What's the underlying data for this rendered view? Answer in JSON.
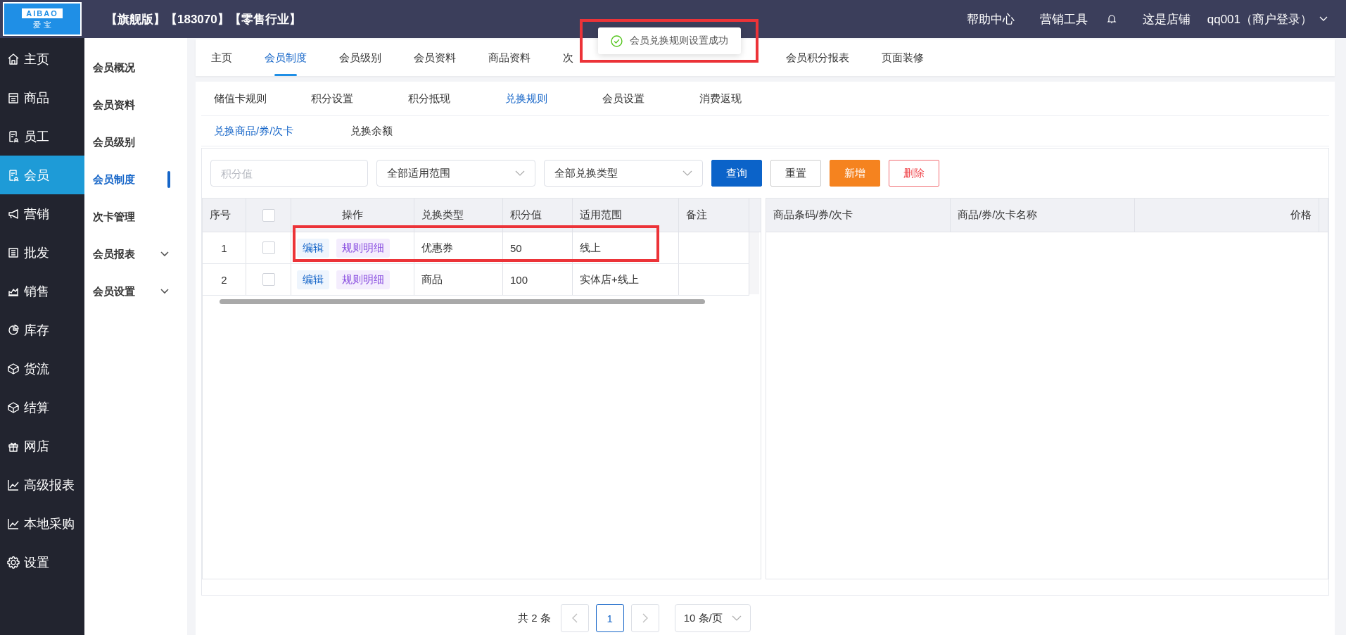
{
  "header": {
    "logo_top": "AIBAO",
    "logo_bottom": "爱 宝",
    "title": "【旗舰版】【183070】【零售行业】",
    "links": [
      "帮助中心",
      "营销工具"
    ],
    "store": "这是店铺",
    "user": "qq001（商户登录）"
  },
  "sidebar": {
    "items": [
      {
        "label": "主页",
        "selected": false
      },
      {
        "label": "商品",
        "selected": false
      },
      {
        "label": "员工",
        "selected": false
      },
      {
        "label": "会员",
        "selected": true
      },
      {
        "label": "营销",
        "selected": false
      },
      {
        "label": "批发",
        "selected": false
      },
      {
        "label": "销售",
        "selected": false
      },
      {
        "label": "库存",
        "selected": false
      },
      {
        "label": "货流",
        "selected": false
      },
      {
        "label": "结算",
        "selected": false
      },
      {
        "label": "网店",
        "selected": false
      },
      {
        "label": "高级报表",
        "selected": false
      },
      {
        "label": "本地采购",
        "selected": false
      },
      {
        "label": "设置",
        "selected": false
      }
    ]
  },
  "submenu": {
    "items": [
      {
        "label": "会员概况",
        "selected": false,
        "kind": "link"
      },
      {
        "label": "会员资料",
        "selected": false,
        "kind": "link"
      },
      {
        "label": "会员级别",
        "selected": false,
        "kind": "link"
      },
      {
        "label": "会员制度",
        "selected": true,
        "kind": "link"
      },
      {
        "label": "次卡管理",
        "selected": false,
        "kind": "link"
      },
      {
        "label": "会员报表",
        "selected": false,
        "kind": "group"
      },
      {
        "label": "会员设置",
        "selected": false,
        "kind": "group"
      }
    ]
  },
  "tabs": [
    {
      "label": "主页",
      "selected": false
    },
    {
      "label": "会员制度",
      "selected": true
    },
    {
      "label": "会员级别",
      "selected": false
    },
    {
      "label": "会员资料",
      "selected": false
    },
    {
      "label": "商品资料",
      "selected": false
    },
    {
      "label": "次",
      "selected": false
    },
    {
      "label": "会员积分报表",
      "selected": false
    },
    {
      "label": "页面装修",
      "selected": false
    }
  ],
  "toast": {
    "message": "会员兑换规则设置成功"
  },
  "sub_tabs": [
    {
      "label": "储值卡规则",
      "selected": false
    },
    {
      "label": "积分设置",
      "selected": false
    },
    {
      "label": "积分抵现",
      "selected": false
    },
    {
      "label": "兑换规则",
      "selected": true
    },
    {
      "label": "会员设置",
      "selected": false
    },
    {
      "label": "消费返现",
      "selected": false
    }
  ],
  "exchange_tabs": [
    {
      "label": "兑换商品/券/次卡",
      "selected": true
    },
    {
      "label": "兑换余额",
      "selected": false
    }
  ],
  "filters": {
    "points_placeholder": "积分值",
    "scope": "全部适用范围",
    "type": "全部兑换类型"
  },
  "buttons": [
    {
      "label": "查询",
      "kind": "primary"
    },
    {
      "label": "重置",
      "kind": "default"
    },
    {
      "label": "新增",
      "kind": "warning"
    },
    {
      "label": "删除",
      "kind": "danger"
    }
  ],
  "rules_table": {
    "columns": [
      "序号",
      "操作",
      "兑换类型",
      "积分值",
      "适用范围",
      "备注"
    ],
    "header_checked": false,
    "rows": [
      {
        "index": "1",
        "checked": false,
        "actions": [
          "编辑",
          "规则明细"
        ],
        "type": "优惠券",
        "points": "50",
        "scope": "线上",
        "annotated": true
      },
      {
        "index": "2",
        "checked": false,
        "actions": [
          "编辑",
          "规则明细"
        ],
        "type": "商品",
        "points": "100",
        "scope": "实体店+线上",
        "annotated": false
      }
    ]
  },
  "detail_table": {
    "columns": [
      "商品条码/券/次卡",
      "商品/券/次卡名称",
      "价格"
    ]
  },
  "pagination": {
    "total": "共 2 条",
    "pages": [
      {
        "label": "1",
        "selected": true
      }
    ],
    "page_size": "10 条/页"
  }
}
